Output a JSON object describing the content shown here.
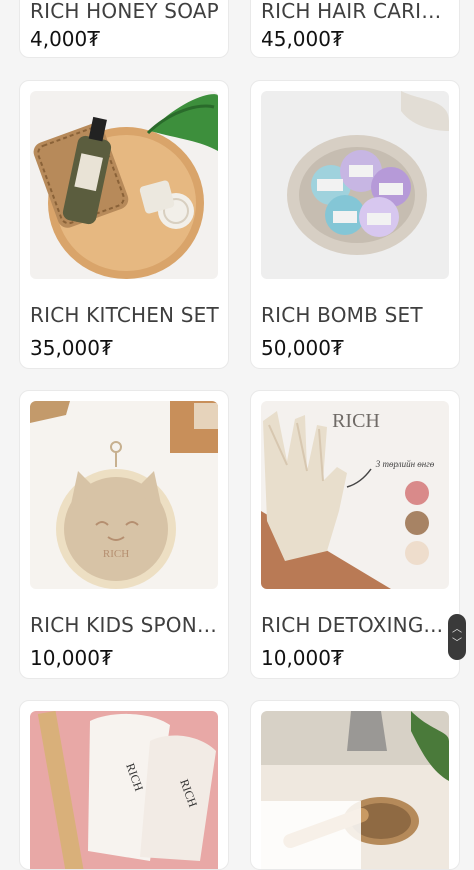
{
  "currency_symbol": "₮",
  "colors": {
    "page_background": "#f5f5f5",
    "card_background": "#ffffff",
    "name_text": "#3f3f3f",
    "price_text": "#111111"
  },
  "products": [
    {
      "name": "RICH HONEY SOAP",
      "price": "4,000₮"
    },
    {
      "name": "RICH HAIR CARIN...",
      "price": "45,000₮"
    },
    {
      "name": "RICH KITCHEN SET",
      "price": "35,000₮"
    },
    {
      "name": "RICH BOMB SET",
      "price": "50,000₮"
    },
    {
      "name": "RICH KIDS SPONGE",
      "price": "10,000₮"
    },
    {
      "name": "RICH DETOXING...",
      "price": "10,000₮"
    },
    {
      "name": "",
      "price": ""
    },
    {
      "name": "",
      "price": ""
    }
  ],
  "image_text": {
    "detox_brand": "RICH",
    "detox_caption": "3 төрлийн өнгө",
    "sponge_brand": "RICH",
    "towel_brand": "RICH"
  },
  "icons": {
    "scroll_up": "chevron-up-icon",
    "scroll_down": "chevron-down-icon"
  }
}
